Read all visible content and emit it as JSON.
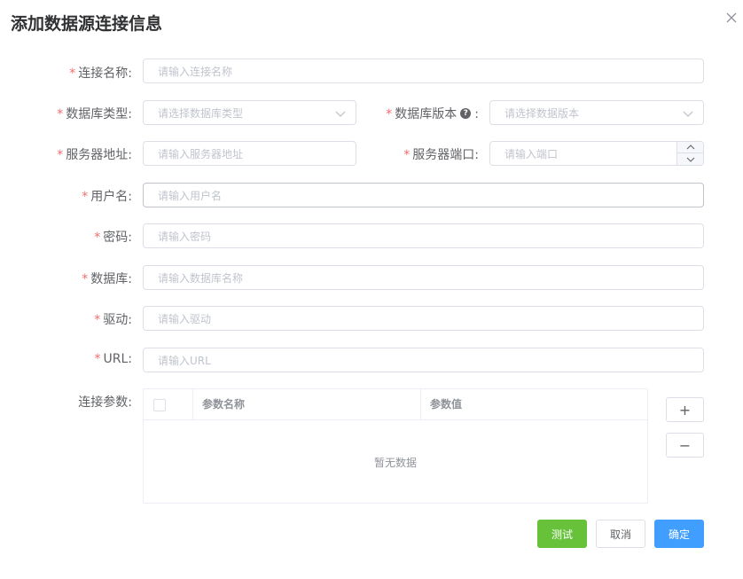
{
  "dialog": {
    "title": "添加数据源连接信息"
  },
  "required_mark": "*",
  "colon": ":",
  "fields": {
    "connection_name": {
      "label": "连接名称:",
      "placeholder": "请输入连接名称"
    },
    "db_type": {
      "label": "数据库类型:",
      "placeholder": "请选择数据库类型"
    },
    "db_version": {
      "label": "数据库版本",
      "placeholder": "请选择数据版本",
      "help": "?"
    },
    "server_address": {
      "label": "服务器地址:",
      "placeholder": "请输入服务器地址"
    },
    "server_port": {
      "label": "服务器端口:",
      "placeholder": "请输入端口"
    },
    "username": {
      "label": "用户名:",
      "placeholder": "请输入用户名"
    },
    "password": {
      "label": "密码:",
      "placeholder": "请输入密码"
    },
    "database": {
      "label": "数据库:",
      "placeholder": "请输入数据库名称"
    },
    "driver": {
      "label": "驱动:",
      "placeholder": "请输入驱动"
    },
    "url": {
      "label": "URL:",
      "placeholder": "请输入URL"
    }
  },
  "params": {
    "label": "连接参数:",
    "columns": [
      "参数名称",
      "参数值"
    ],
    "empty_text": "暂无数据",
    "add_label": "+",
    "remove_label": "−"
  },
  "buttons": {
    "test": "测试",
    "cancel": "取消",
    "ok": "确定"
  },
  "colors": {
    "primary": "#409eff",
    "success": "#67c23a",
    "danger": "#f56c6c"
  }
}
